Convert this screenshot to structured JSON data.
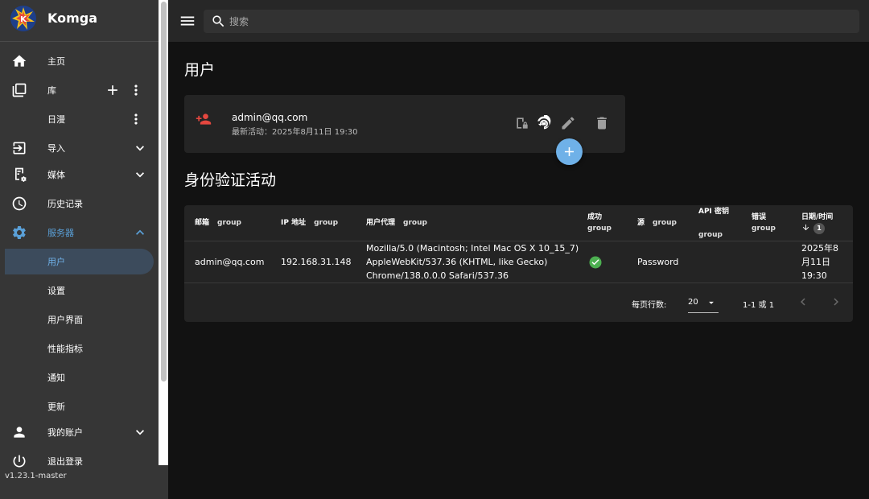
{
  "app": {
    "name": "Komga",
    "version": "v1.23.1-master"
  },
  "sidebar": {
    "items": [
      {
        "label": "主页",
        "icon": "home-icon"
      },
      {
        "label": "库",
        "icon": "library-icon"
      },
      {
        "label": "日漫",
        "icon": ""
      },
      {
        "label": "导入",
        "icon": "import-icon"
      },
      {
        "label": "媒体",
        "icon": "media-icon"
      },
      {
        "label": "历史记录",
        "icon": "history-icon"
      },
      {
        "label": "服务器",
        "icon": "gear-icon"
      },
      {
        "label": "用户",
        "icon": ""
      },
      {
        "label": "设置",
        "icon": ""
      },
      {
        "label": "用户界面",
        "icon": ""
      },
      {
        "label": "性能指标",
        "icon": ""
      },
      {
        "label": "通知",
        "icon": ""
      },
      {
        "label": "更新",
        "icon": ""
      },
      {
        "label": "我的账户",
        "icon": "account-icon"
      },
      {
        "label": "退出登录",
        "icon": "power-icon"
      }
    ],
    "active_item": "用户"
  },
  "search": {
    "placeholder": "搜索",
    "value": ""
  },
  "users_section": {
    "title": "用户",
    "users": [
      {
        "email": "admin@qq.com",
        "last_activity": "最新活动：2025年8月11日 19:30"
      }
    ]
  },
  "auth_section": {
    "title": "身份验证活动",
    "columns": [
      {
        "label": "邮箱",
        "group": "group"
      },
      {
        "label": "IP 地址",
        "group": "group"
      },
      {
        "label": "用户代理",
        "group": "group"
      },
      {
        "label": "成功",
        "group": "group"
      },
      {
        "label": "源",
        "group": "group"
      },
      {
        "label": "API 密钥",
        "group": "group"
      },
      {
        "label": "错误",
        "group": "group"
      },
      {
        "label": "日期/时间",
        "sort_order": "1"
      }
    ],
    "rows": [
      {
        "email": "admin@qq.com",
        "ip": "192.168.31.148",
        "user_agent_1": "Mozilla/5.0 (Macintosh; Intel Mac OS X 10_15_7)",
        "user_agent_2": "AppleWebKit/537.36 (KHTML, like Gecko)",
        "user_agent_3": "Chrome/138.0.0.0 Safari/537.36",
        "success": true,
        "source": "Password",
        "api_key": "",
        "error": "",
        "datetime_1": "2025年8",
        "datetime_2": "月11日",
        "datetime_3": "19:30"
      }
    ],
    "pagination": {
      "rows_per_page_label": "每页行数:",
      "rows_per_page": "20",
      "range": "1-1 或 1"
    }
  },
  "colors": {
    "accent": "#6fb1e8",
    "user_icon": "#e5473f",
    "success": "#4caf50",
    "sidebar_bg": "#363636",
    "main_bg": "#121212"
  }
}
